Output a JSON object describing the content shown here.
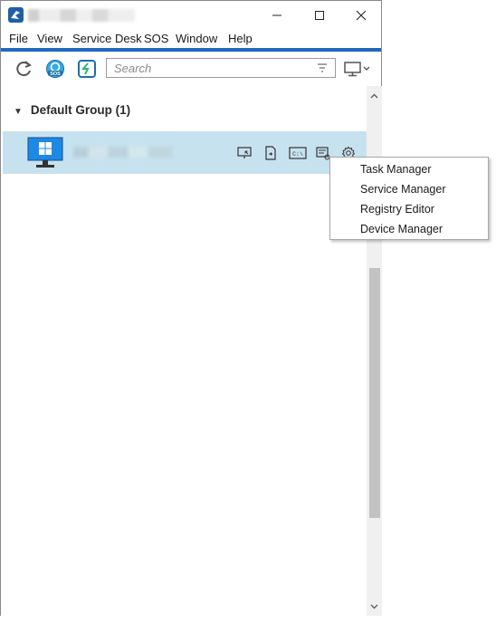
{
  "window": {
    "minimize_glyph": "—",
    "maximize_glyph": "☐",
    "close_glyph": "✕"
  },
  "menubar": {
    "items": [
      {
        "label": "File"
      },
      {
        "label": "View"
      },
      {
        "label": "Service Desk"
      },
      {
        "label": "SOS"
      },
      {
        "label": "Window"
      },
      {
        "label": "Help"
      }
    ]
  },
  "toolbar": {
    "refresh_icon": "refresh-icon",
    "sos_icon": "sos-icon",
    "sos_label": "SOS",
    "remote_icon": "remote-connect-icon",
    "search_placeholder": "Search",
    "filter_icon": "filter-icon",
    "view_icon": "monitor-view-icon"
  },
  "group": {
    "arrow": "▼",
    "label": "Default Group (1)"
  },
  "device": {
    "icon": "windows-monitor-icon",
    "actions": [
      "remote-view-icon",
      "file-transfer-icon",
      "command-prompt-icon",
      "system-info-icon",
      "settings-gear-icon"
    ],
    "cmd_label": "C:\\"
  },
  "context_menu": {
    "items": [
      {
        "label": "Task Manager"
      },
      {
        "label": "Service Manager"
      },
      {
        "label": "Registry Editor"
      },
      {
        "label": "Device Manager"
      }
    ]
  },
  "colors": {
    "accent": "#2068c0",
    "row_selected": "#c7e2ef",
    "windows_blue": "#1e88e5"
  }
}
